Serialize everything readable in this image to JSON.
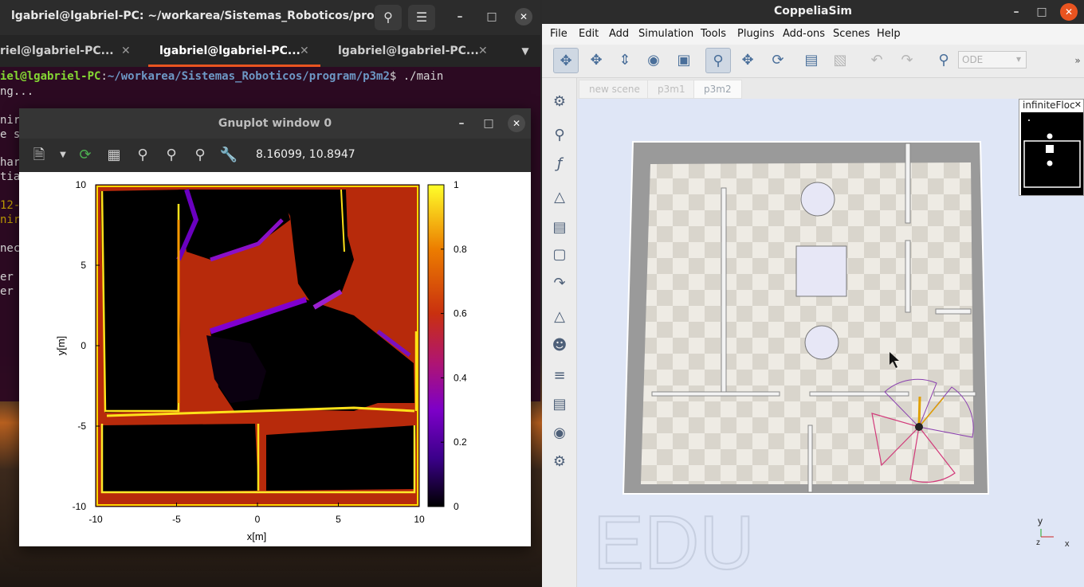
{
  "terminal": {
    "title": "lgabriel@lgabriel-PC: ~/workarea/Sistemas_Roboticos/prog...",
    "tabs": [
      {
        "label": "riel@lgabriel-PC..."
      },
      {
        "label": "lgabriel@lgabriel-PC..."
      },
      {
        "label": "lgabriel@lgabriel-PC..."
      }
    ],
    "prompt_user": "iel@lgabriel-PC",
    "prompt_path": "~/workarea/Sistemas_Roboticos/program/p3m2",
    "prompt_cmd": "$ ./main",
    "lines": [
      "ng...",
      "nir",
      "e s",
      "har",
      "tia",
      "12-",
      "nir",
      "nec",
      " er",
      "er"
    ]
  },
  "gnuplot": {
    "title": "Gnuplot window 0",
    "coords": "8.16099,  10.8947"
  },
  "chart_data": {
    "type": "heatmap",
    "title": "",
    "xlabel": "x[m]",
    "ylabel": "y[m]",
    "xlim": [
      -10,
      10
    ],
    "ylim": [
      -10,
      10
    ],
    "xticks": [
      "-10",
      "-5",
      "0",
      "5",
      "10"
    ],
    "yticks": [
      "10",
      "5",
      "0",
      "-5",
      "-10"
    ],
    "colorbar": {
      "range": [
        0,
        1
      ],
      "ticks": [
        "1",
        "0.8",
        "0.6",
        "0.4",
        "0.2",
        "0"
      ]
    },
    "palette": [
      "#000000",
      "#5b00b4",
      "#a40a6c",
      "#c43a0e",
      "#e87b00",
      "#ffd21e",
      "#ffff3c"
    ],
    "legend": "none",
    "grid": false
  },
  "coppelia": {
    "title": "CoppeliaSim",
    "menus": [
      "File",
      "Edit",
      "Add",
      "Simulation",
      "Tools",
      "Plugins",
      "Add-ons",
      "Scenes",
      "Help"
    ],
    "engine": "ODE",
    "scene_tabs": [
      "new scene",
      "p3m1",
      "p3m2"
    ],
    "float_view_title": "infiniteFloc",
    "watermark": "EDU",
    "axis_labels": {
      "y": "y",
      "z": "z",
      "x": "x"
    }
  },
  "colors": {
    "terminal_bg": "#2d0922",
    "tab_accent": "#e95420",
    "coppelia_bg": "#dfe6f6"
  }
}
